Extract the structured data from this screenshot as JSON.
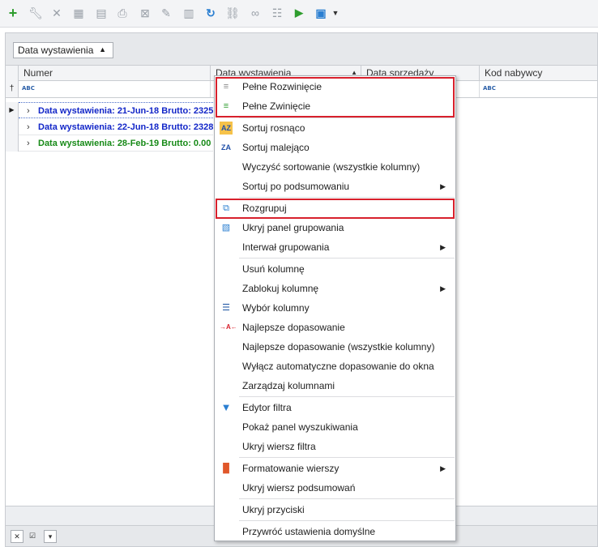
{
  "toolbar": {
    "icons": [
      "add-icon",
      "wrench-icon",
      "close-icon",
      "calculator-icon",
      "save-icon",
      "print-icon",
      "cross-box-icon",
      "edit-icon",
      "table-icon",
      "refresh-icon",
      "chain-icon",
      "link-icon",
      "tree-icon",
      "play-icon",
      "window-icon",
      "dropdown-icon"
    ]
  },
  "group_panel": {
    "chip_label": "Data wystawienia"
  },
  "columns": [
    {
      "label": "Numer"
    },
    {
      "label": "Data wystawienia"
    },
    {
      "label": "Data sprzedaży"
    },
    {
      "label": "Kod nabywcy"
    }
  ],
  "filter_row": {
    "abc_label": "BC"
  },
  "groups": [
    {
      "text": "Data wystawienia: 21-Jun-18 Brutto: 23253",
      "color": "blue"
    },
    {
      "text": "Data wystawienia: 22-Jun-18 Brutto: 2328.",
      "color": "blue"
    },
    {
      "text": "Data wystawienia: 28-Feb-19 Brutto: 0.00",
      "color": "green"
    }
  ],
  "menu": {
    "items": [
      {
        "label": "Pełne Rozwinięcie",
        "icon": "expand-all-icon",
        "submenu": false
      },
      {
        "label": "Pełne Zwinięcie",
        "icon": "collapse-all-icon",
        "submenu": false
      },
      {
        "label": "Sortuj rosnąco",
        "icon": "sort-ascending-icon",
        "submenu": false
      },
      {
        "label": "Sortuj malejąco",
        "icon": "sort-descending-icon",
        "submenu": false
      },
      {
        "label": "Wyczyść sortowanie (wszystkie kolumny)",
        "icon": "",
        "submenu": false
      },
      {
        "label": "Sortuj po podsumowaniu",
        "icon": "",
        "submenu": true
      },
      {
        "label": "Rozgrupuj",
        "icon": "ungroup-icon",
        "submenu": false
      },
      {
        "label": "Ukryj panel grupowania",
        "icon": "group-panel-icon",
        "submenu": false
      },
      {
        "label": "Interwał grupowania",
        "icon": "",
        "submenu": true
      },
      {
        "label": "Usuń kolumnę",
        "icon": "",
        "submenu": false
      },
      {
        "label": "Zablokuj kolumnę",
        "icon": "",
        "submenu": true
      },
      {
        "label": "Wybór kolumny",
        "icon": "column-chooser-icon",
        "submenu": false
      },
      {
        "label": "Najlepsze dopasowanie",
        "icon": "best-fit-icon",
        "submenu": false
      },
      {
        "label": "Najlepsze dopasowanie (wszystkie kolumny)",
        "icon": "",
        "submenu": false
      },
      {
        "label": "Wyłącz automatyczne dopasowanie do okna",
        "icon": "",
        "submenu": false
      },
      {
        "label": "Zarządzaj kolumnami",
        "icon": "",
        "submenu": false
      },
      {
        "label": "Edytor filtra",
        "icon": "filter-icon",
        "submenu": false
      },
      {
        "label": "Pokaż panel wyszukiwania",
        "icon": "",
        "submenu": false
      },
      {
        "label": "Ukryj wiersz filtra",
        "icon": "",
        "submenu": false
      },
      {
        "label": "Formatowanie wierszy",
        "icon": "row-format-icon",
        "submenu": true
      },
      {
        "label": "Ukryj wiersz podsumowań",
        "icon": "",
        "submenu": false
      },
      {
        "label": "Ukryj przyciski",
        "icon": "",
        "submenu": false
      },
      {
        "label": "Przywróć ustawienia domyślne",
        "icon": "",
        "submenu": false
      }
    ]
  },
  "colors": {
    "highlight_border": "#d8202c",
    "group_blue": "#1226c8",
    "group_green": "#178a17",
    "accent_icon_blue": "#2b7fd1"
  }
}
